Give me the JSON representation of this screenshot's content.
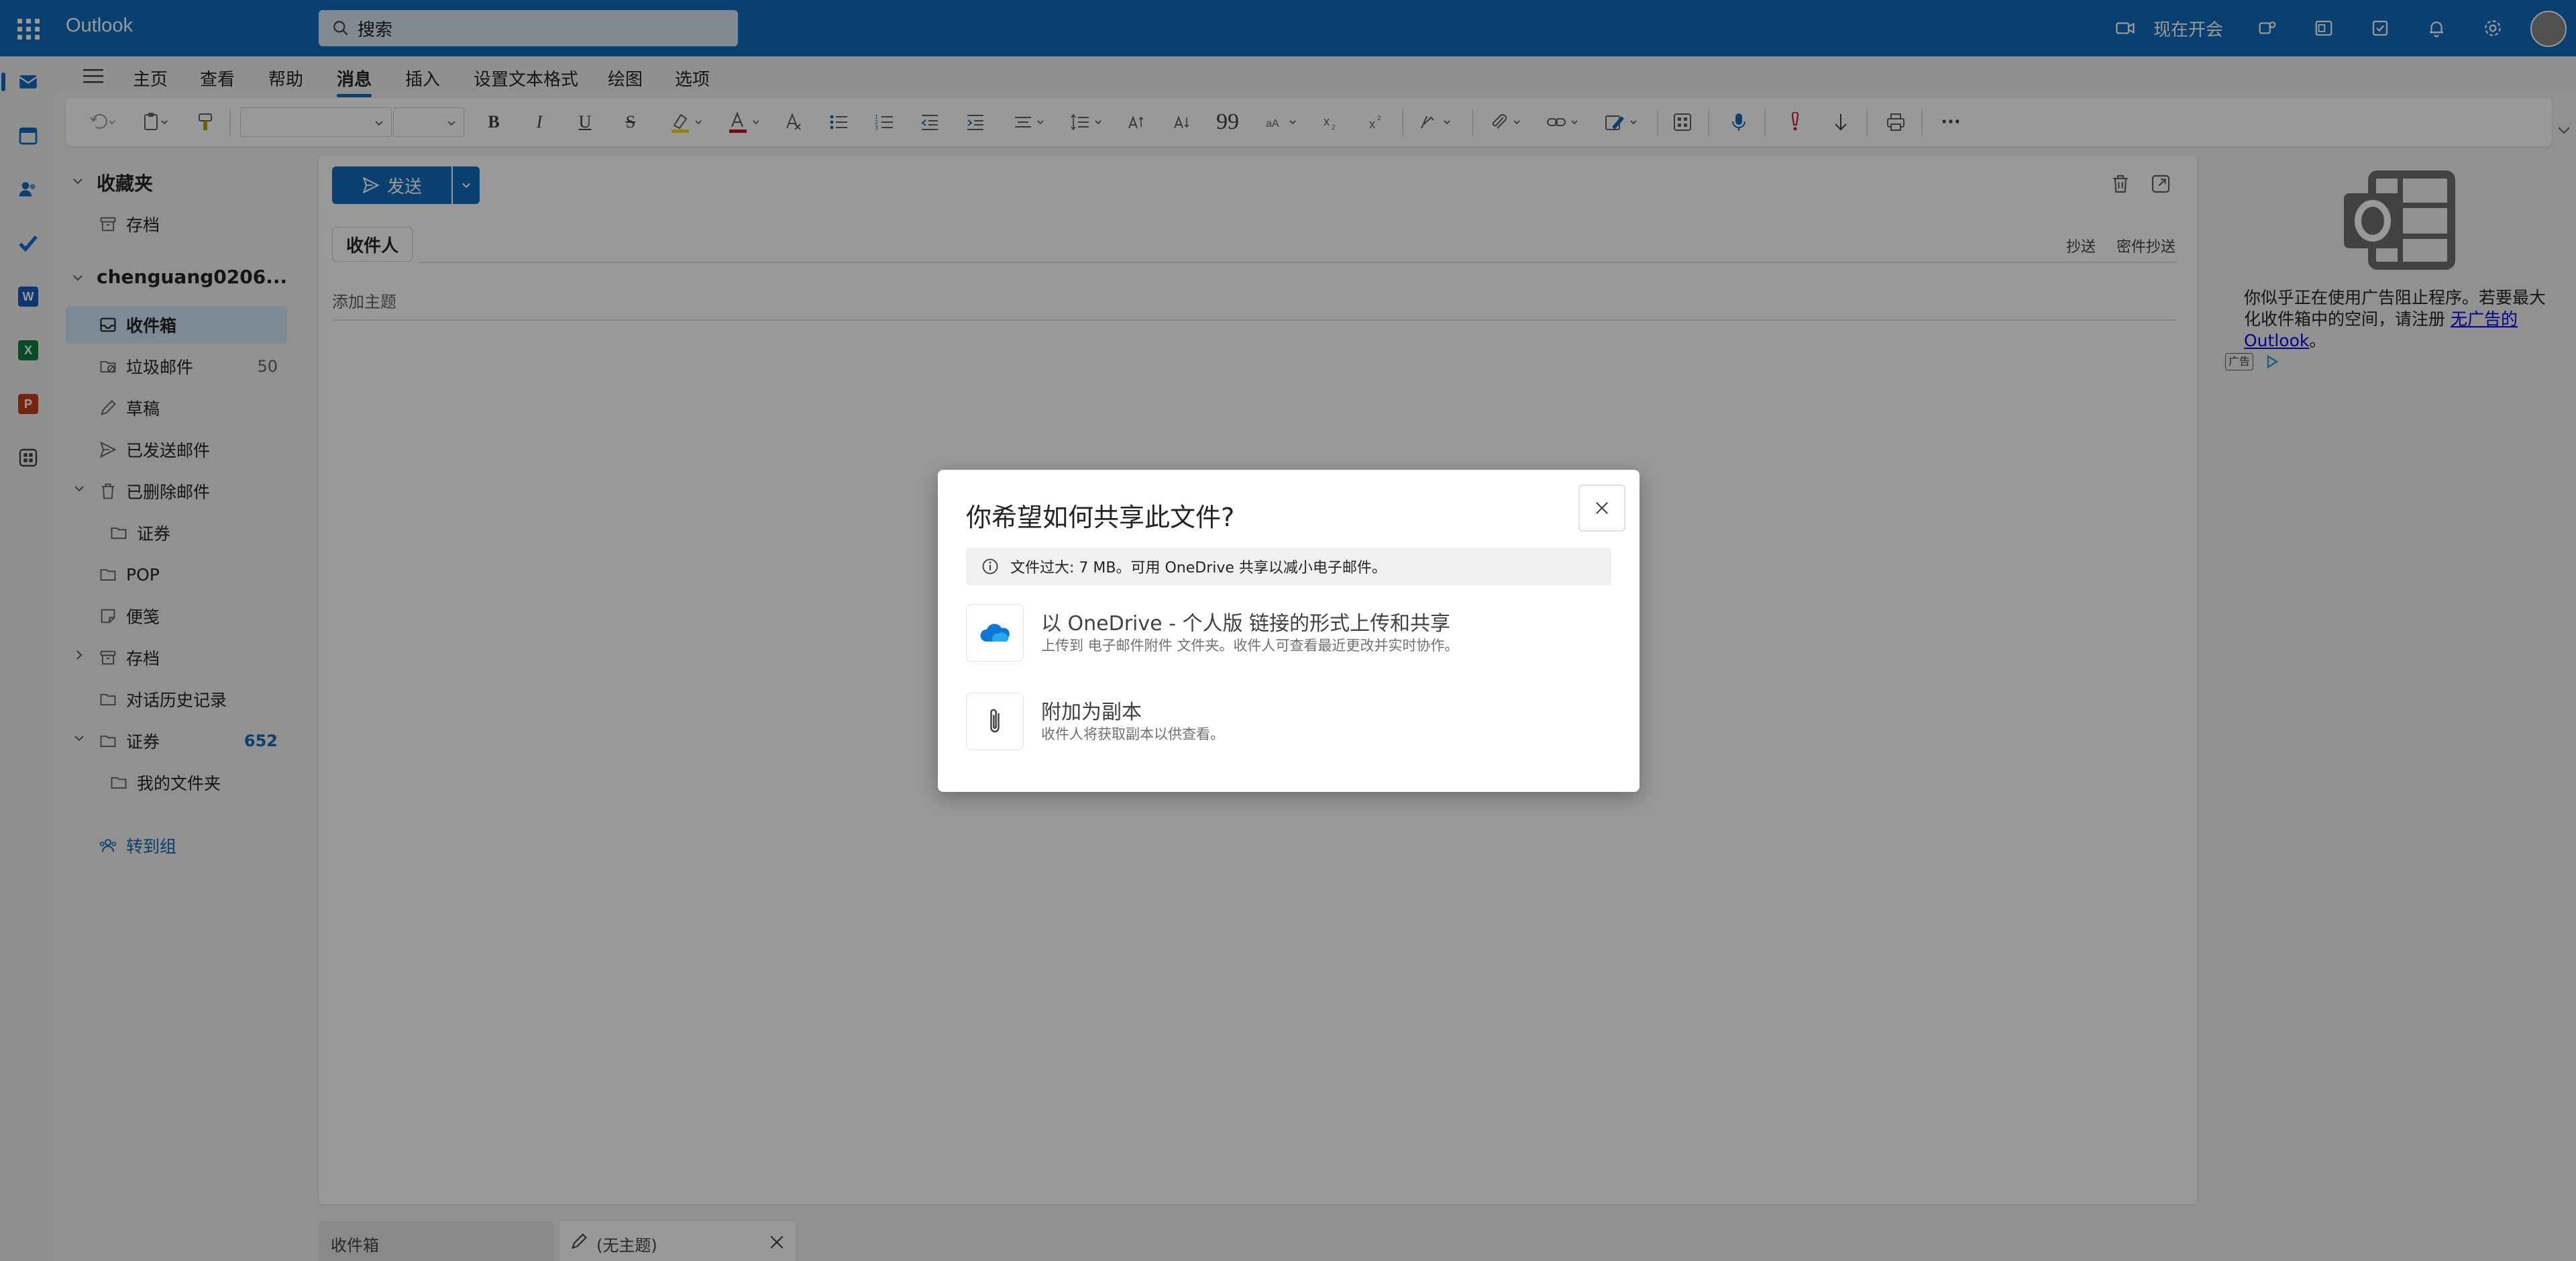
{
  "header": {
    "brand": "Outlook",
    "search_placeholder": "搜索",
    "meet_now": "现在开会"
  },
  "ribbon": {
    "tabs": [
      "主页",
      "查看",
      "帮助",
      "消息",
      "插入",
      "设置文本格式",
      "绘图",
      "选项"
    ],
    "active_tab": "消息"
  },
  "toolbar": {
    "more": "···"
  },
  "folders": {
    "favorites_header": "收藏夹",
    "favorites": [
      {
        "label": "存档"
      }
    ],
    "account_header": "chenguang0206...",
    "items": [
      {
        "label": "收件箱",
        "count": ""
      },
      {
        "label": "垃圾邮件",
        "count": "50"
      },
      {
        "label": "草稿",
        "count": ""
      },
      {
        "label": "已发送邮件",
        "count": ""
      },
      {
        "label": "已删除邮件",
        "count": ""
      },
      {
        "label": "证券",
        "count": ""
      },
      {
        "label": "POP",
        "count": ""
      },
      {
        "label": "便笺",
        "count": ""
      },
      {
        "label": "存档",
        "count": ""
      },
      {
        "label": "对话历史记录",
        "count": ""
      },
      {
        "label": "证券",
        "count": "652"
      },
      {
        "label": "我的文件夹",
        "count": ""
      }
    ],
    "go_to_groups": "转到组"
  },
  "compose": {
    "send": "发送",
    "to": "收件人",
    "cc": "抄送",
    "bcc": "密件抄送",
    "subject_placeholder": "添加主题"
  },
  "ad": {
    "text_prefix": "你似乎正在使用广告阻止程序。若要最大化收件箱中的空间，请注册 ",
    "link": "无广告的 Outlook",
    "text_suffix": "。",
    "badge": "广告"
  },
  "bottom_tabs": {
    "inbox": "收件箱",
    "draft": "(无主题)"
  },
  "dialog": {
    "title": "你希望如何共享此文件?",
    "info": "文件过大: 7 MB。可用 OneDrive 共享以减小电子邮件。",
    "option1_title": "以 OneDrive - 个人版 链接的形式上传和共享",
    "option1_desc": "上传到 电子邮件附件 文件夹。收件人可查看最近更改并实时协作。",
    "option2_title": "附加为副本",
    "option2_desc": "收件人将获取副本以供查看。"
  },
  "colors": {
    "brand": "#0f6cbd",
    "selected": "#cfe4fa"
  }
}
